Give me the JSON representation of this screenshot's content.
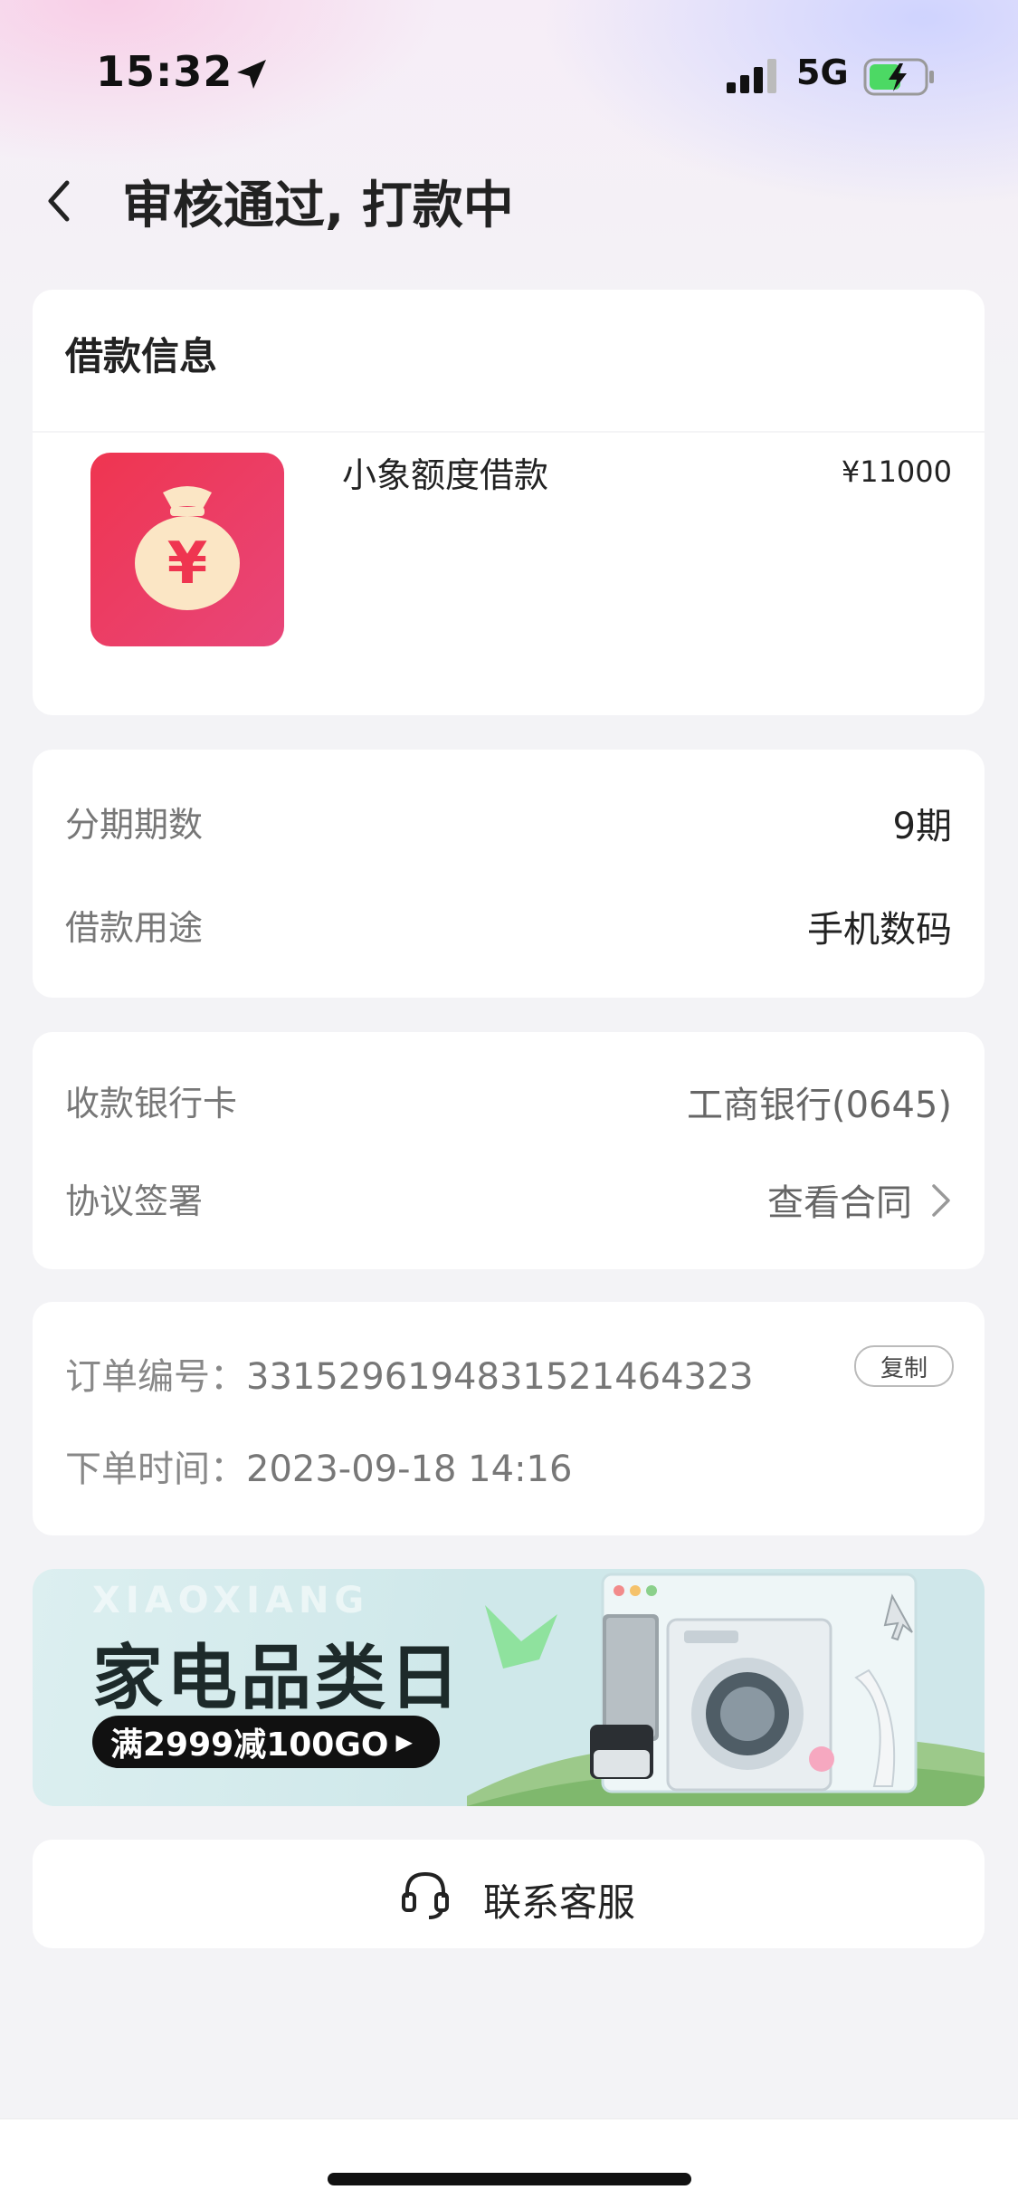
{
  "status_bar": {
    "time": "15:32",
    "network": "5G"
  },
  "nav": {
    "title": "审核通过, 打款中"
  },
  "loan_info": {
    "title": "借款信息",
    "product_name": "小象额度借款",
    "amount": "¥11000",
    "icon": "money-bag-icon"
  },
  "installment": {
    "periods_label": "分期期数",
    "periods_value": "9期",
    "purpose_label": "借款用途",
    "purpose_value": "手机数码"
  },
  "bank": {
    "card_label": "收款银行卡",
    "card_value": "工商银行(0645)",
    "agreement_label": "协议签署",
    "agreement_value": "查看合同"
  },
  "order": {
    "number_label": "订单编号：",
    "number_value": "331529619483152146432З",
    "copy_label": "复制",
    "time_label": "下单时间：",
    "time_value": "2023-09-18 14:16"
  },
  "banner": {
    "ghost_text": "XIAOXIANG",
    "title": "家电品类日",
    "promo": "满2999减100GO"
  },
  "service": {
    "label": "联系客服",
    "icon": "headset-icon"
  },
  "colors": {
    "accent": "#ef3550",
    "background": "#f3f3f6"
  }
}
